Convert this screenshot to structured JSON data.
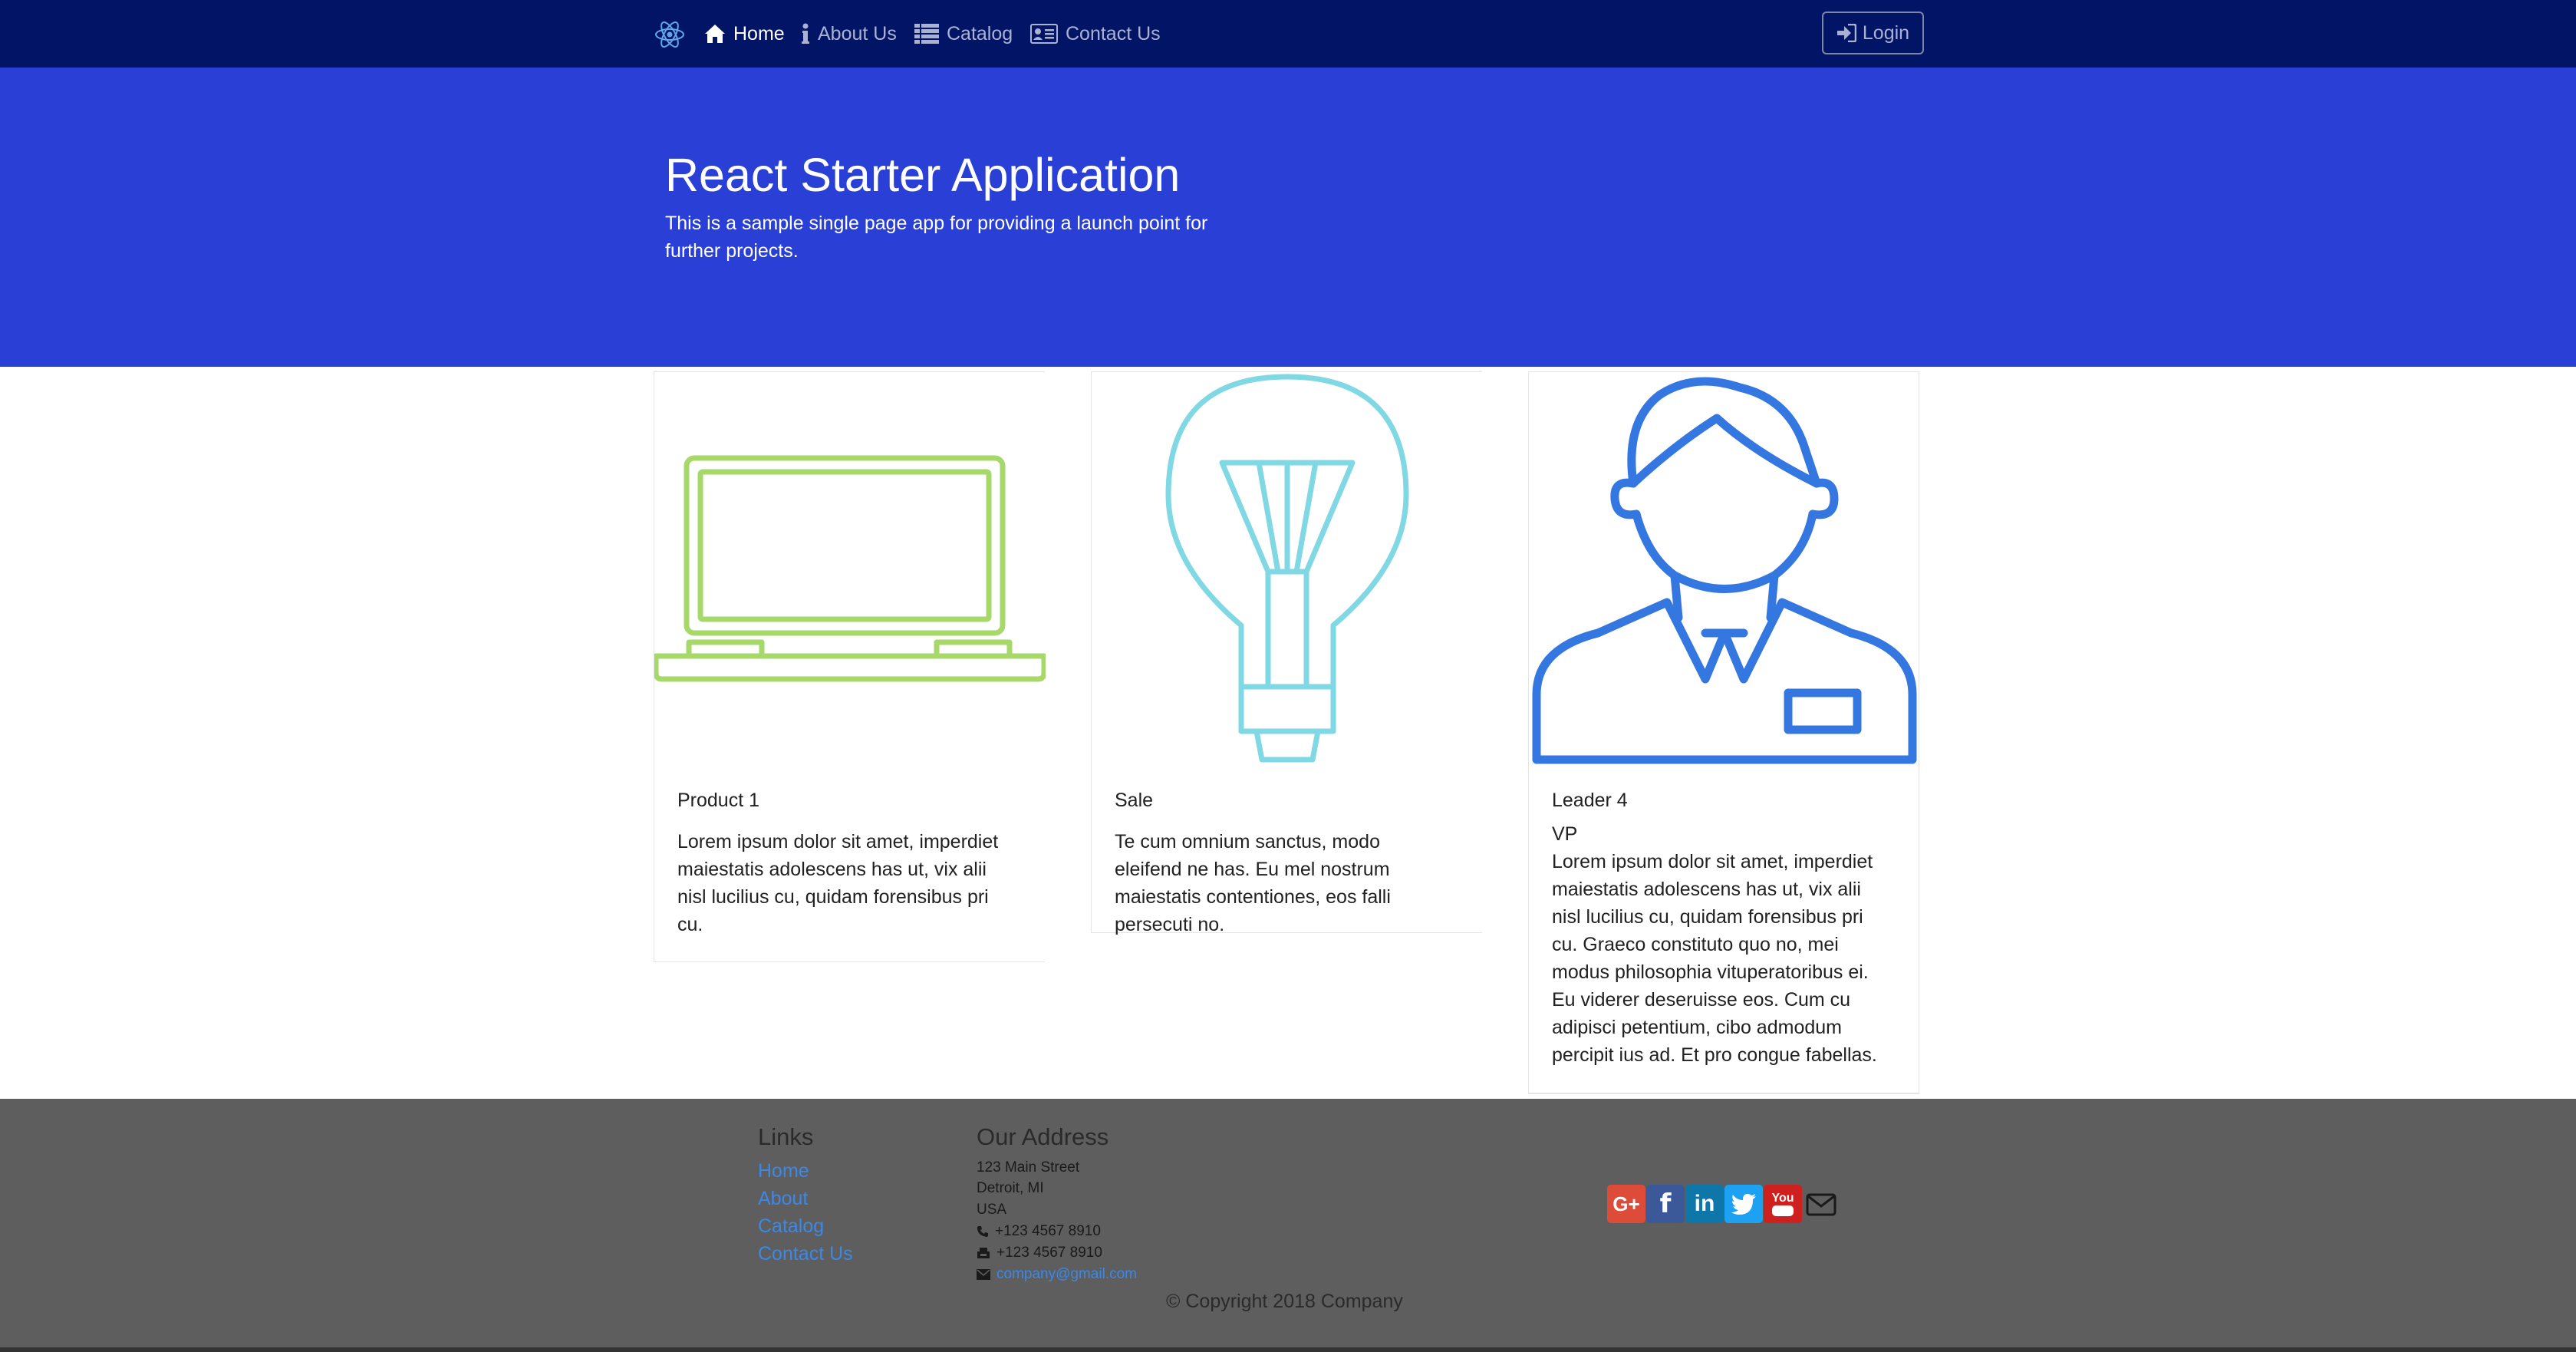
{
  "nav": {
    "items": [
      {
        "label": "Home",
        "icon": "home-icon",
        "active": true
      },
      {
        "label": "About Us",
        "icon": "info-icon",
        "active": false
      },
      {
        "label": "Catalog",
        "icon": "list-icon",
        "active": false
      },
      {
        "label": "Contact Us",
        "icon": "address-card-icon",
        "active": false
      }
    ],
    "login_label": "Login",
    "brand_icon": "react-logo-icon"
  },
  "hero": {
    "title": "React Starter Application",
    "subtitle": "This is a sample single page app for providing a launch point for further projects."
  },
  "cards": [
    {
      "image": "laptop-icon",
      "title": "Product 1",
      "text": "Lorem ipsum dolor sit amet, imperdiet maiestatis adolescens has ut, vix alii nisl lucilius cu, quidam forensibus pri cu."
    },
    {
      "image": "lightbulb-icon",
      "title": "Sale",
      "text": "Te cum omnium sanctus, modo eleifend ne has. Eu mel nostrum maiestatis contentiones, eos falli persecuti no."
    },
    {
      "image": "person-icon",
      "title": "Leader 4",
      "subtitle": "VP",
      "text": "Lorem ipsum dolor sit amet, imperdiet maiestatis adolescens has ut, vix alii nisl lucilius cu, quidam forensibus pri cu. Graeco constituto quo no, mei modus philosophia vituperatoribus ei. Eu viderer deseruisse eos. Cum cu adipisci petentium, cibo admodum percipit ius ad. Et pro congue fabellas."
    }
  ],
  "footer": {
    "links_heading": "Links",
    "links": [
      "Home",
      "About",
      "Catalog",
      "Contact Us"
    ],
    "address_heading": "Our Address",
    "address": [
      "123 Main Street",
      "Detroit, MI",
      "USA"
    ],
    "phone": "+123 4567 8910",
    "fax": "+123 4567 8910",
    "email": "company@gmail.com",
    "social": [
      {
        "name": "google-plus",
        "label": "G+",
        "color": "#dd4b39"
      },
      {
        "name": "facebook",
        "label": "f",
        "color": "#3b5998"
      },
      {
        "name": "linkedin",
        "label": "in",
        "color": "#0e76a8"
      },
      {
        "name": "twitter",
        "label": "t",
        "color": "#1da1f2"
      },
      {
        "name": "youtube",
        "label": "You",
        "color": "#cd201f"
      }
    ],
    "copyright": "© Copyright 2018 Company"
  },
  "colors": {
    "navbar": "#021466",
    "hero": "#2a3fd6",
    "footer": "#5e5e5e",
    "link": "#3d88e6",
    "laptop": "#a6d96a",
    "bulb": "#7fd8e4",
    "person": "#3477e0"
  }
}
